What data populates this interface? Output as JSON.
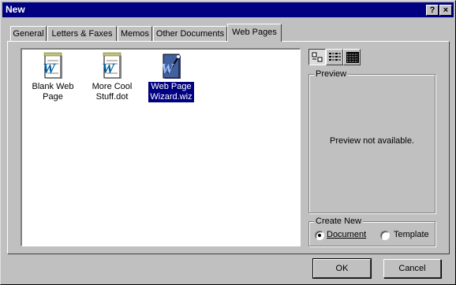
{
  "window": {
    "title": "New",
    "help_button": "?",
    "close_button": "×"
  },
  "tabs": [
    {
      "label": "General",
      "active": false
    },
    {
      "label": "Letters & Faxes",
      "active": false
    },
    {
      "label": "Memos",
      "active": false
    },
    {
      "label": "Other Documents",
      "active": false
    },
    {
      "label": "Web Pages",
      "active": true
    }
  ],
  "templates": [
    {
      "line1": "Blank Web",
      "line2": "Page",
      "icon": "word-document-icon",
      "selected": false
    },
    {
      "line1": "More Cool",
      "line2": "Stuff.dot",
      "icon": "word-document-icon",
      "selected": false
    },
    {
      "line1": "Web Page",
      "line2": "Wizard.wiz",
      "icon": "word-wizard-icon",
      "selected": true
    }
  ],
  "view_buttons": [
    {
      "icon": "large-icons-icon",
      "pressed": true
    },
    {
      "icon": "list-icon",
      "pressed": false
    },
    {
      "icon": "details-icon",
      "pressed": false
    }
  ],
  "preview": {
    "legend": "Preview",
    "message": "Preview not available."
  },
  "create_new": {
    "legend": "Create New",
    "options": [
      {
        "label": "Document",
        "selected": true
      },
      {
        "label": "Template",
        "selected": false
      }
    ]
  },
  "buttons": {
    "ok": "OK",
    "cancel": "Cancel"
  },
  "colors": {
    "title_bar": "#000080",
    "face": "#c0c0c0",
    "selection": "#000080"
  }
}
